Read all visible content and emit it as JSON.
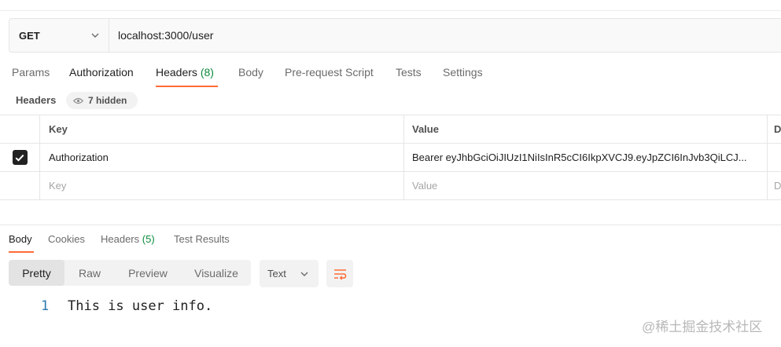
{
  "request": {
    "method": "GET",
    "url": "localhost:3000/user"
  },
  "request_tabs": [
    {
      "label": "Params"
    },
    {
      "label": "Authorization"
    },
    {
      "label": "Headers",
      "count": "(8)",
      "active": true
    },
    {
      "label": "Body"
    },
    {
      "label": "Pre-request Script"
    },
    {
      "label": "Tests"
    },
    {
      "label": "Settings"
    }
  ],
  "headers_section": {
    "title": "Headers",
    "hidden_label": "7 hidden"
  },
  "headers_table": {
    "columns": {
      "key": "Key",
      "value": "Value",
      "description": "D"
    },
    "rows": [
      {
        "checked": true,
        "key": "Authorization",
        "value": "Bearer eyJhbGciOiJIUzI1NiIsInR5cCI6IkpXVCJ9.eyJpZCI6InJvb3QiLCJ...",
        "description": ""
      }
    ],
    "placeholder": {
      "key": "Key",
      "value": "Value",
      "description": "D"
    }
  },
  "response_tabs": [
    {
      "label": "Body",
      "active": true
    },
    {
      "label": "Cookies"
    },
    {
      "label": "Headers",
      "count": "(5)"
    },
    {
      "label": "Test Results"
    }
  ],
  "view_modes": [
    {
      "label": "Pretty",
      "active": true
    },
    {
      "label": "Raw"
    },
    {
      "label": "Preview"
    },
    {
      "label": "Visualize"
    }
  ],
  "format_select": "Text",
  "response_body": {
    "line_number": "1",
    "text": "This is user info."
  },
  "watermark": "@稀土掘金技术社区",
  "colors": {
    "accent": "#ff6c37",
    "count_green": "#0b8a3d",
    "line_number_blue": "#2a7ab0"
  }
}
